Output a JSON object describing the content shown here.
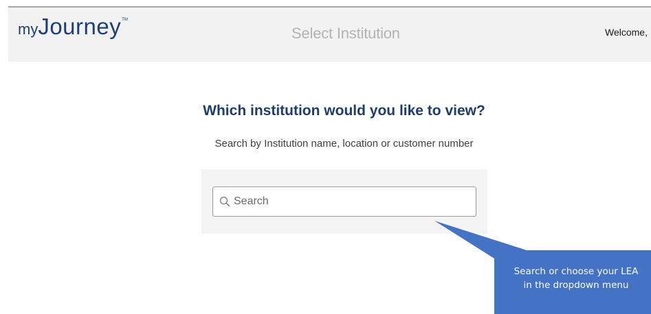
{
  "header": {
    "logo": {
      "prefix": "my",
      "main": "Journey",
      "trademark": "TM"
    },
    "page_title": "Select Institution",
    "welcome_text": "Welcome,"
  },
  "main": {
    "heading": "Which institution would you like to view?",
    "subheading": "Search by Institution name, location or customer number",
    "search": {
      "placeholder": "Search",
      "value": "",
      "icon": "search-icon"
    }
  },
  "callout": {
    "line1": "Search or choose your LEA",
    "line2": "in the dropdown menu",
    "color": "#4472c4"
  },
  "colors": {
    "brand": "#1f3f73",
    "heading": "#1f3d6c",
    "header_bg": "#f2f2f2",
    "panel_bg": "#f4f4f4"
  }
}
